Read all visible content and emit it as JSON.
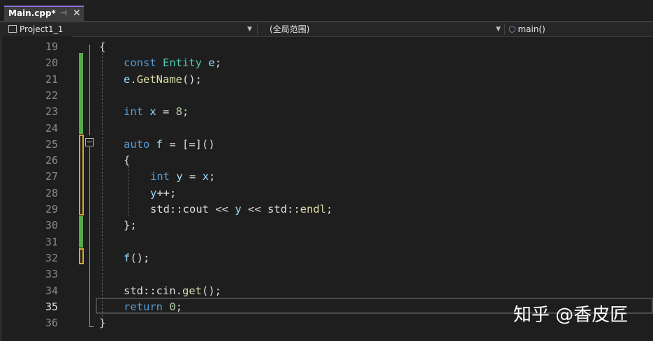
{
  "tab": {
    "title": "Main.cpp*",
    "pin": "⊣",
    "close": "✕"
  },
  "nav": {
    "project": "Project1_1",
    "scope": "(全局范围)",
    "member": "main()"
  },
  "gutter": {
    "line_numbers": [
      "19",
      "20",
      "21",
      "22",
      "23",
      "24",
      "25",
      "26",
      "27",
      "28",
      "29",
      "30",
      "31",
      "32",
      "33",
      "34",
      "35",
      "36"
    ],
    "current_line": "35"
  },
  "code": {
    "l19": [
      "{"
    ],
    "l20": [
      "const",
      " ",
      "Entity",
      " ",
      "e",
      ";"
    ],
    "l21": [
      "e",
      ".",
      "GetName",
      "();"
    ],
    "l23": [
      "int",
      " ",
      "x",
      " = ",
      "8",
      ";"
    ],
    "l25": [
      "auto",
      " ",
      "f",
      " = [=]()"
    ],
    "l26": [
      "{"
    ],
    "l27": [
      "int",
      " ",
      "y",
      " = ",
      "x",
      ";"
    ],
    "l28": [
      "y",
      "++;"
    ],
    "l29": [
      "std",
      "::",
      "cout",
      " << ",
      "y",
      " << ",
      "std",
      "::",
      "endl",
      ";"
    ],
    "l30": [
      "};"
    ],
    "l32": [
      "f",
      "();"
    ],
    "l34": [
      "std",
      "::",
      "cin",
      ".",
      "get",
      "();"
    ],
    "l35": [
      "return",
      " ",
      "0",
      ";"
    ],
    "l36": [
      "}"
    ]
  },
  "watermark": "知乎 @香皮匠",
  "colors": {
    "keyword": "#569cd6",
    "type": "#4ec9b0",
    "function": "#dcdcaa",
    "variable": "#9cdcfe",
    "number": "#b5cea8",
    "change_saved": "#55aa4a",
    "change_unsaved": "#d7a93a",
    "tab_accent": "#8b6fd8"
  }
}
